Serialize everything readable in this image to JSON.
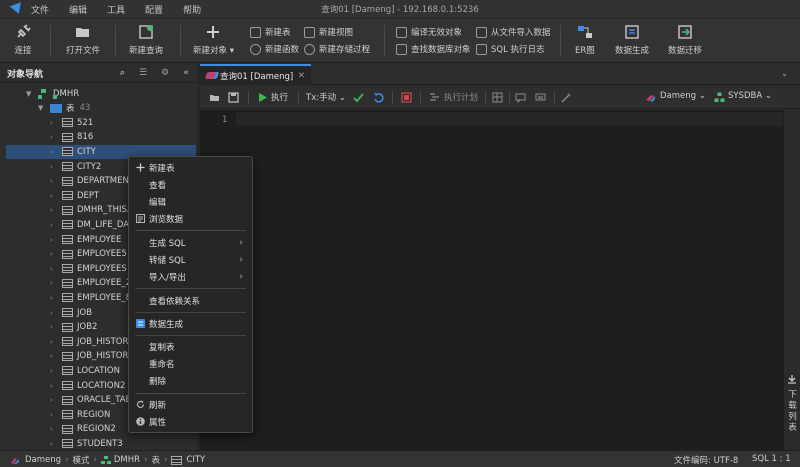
{
  "menubar": {
    "items": [
      "文件",
      "编辑",
      "工具",
      "配置",
      "帮助"
    ],
    "window_title": "查询01 [Dameng] - 192.168.0.1:5236"
  },
  "toolbar": {
    "connect": "连接",
    "open_file": "打开文件",
    "new_query": "新建查询",
    "new_object": "新建对象",
    "new_table": "新建表",
    "new_function": "新建函数",
    "new_view": "新建视图",
    "new_procedure": "新建存储过程",
    "compile_invalid": "编译无效对象",
    "find_db_object": "查找数据库对象",
    "import_from_file": "从文件导入数据",
    "sql_exec_log": "SQL 执行日志",
    "er_diagram": "ER图",
    "data_generation": "数据生成",
    "data_migration": "数据迁移"
  },
  "navigator": {
    "title": "对象导航",
    "schema": "DMHR",
    "tables_folder": "表",
    "tables_count": "43",
    "tables": [
      "521",
      "816",
      "CITY",
      "CITY2",
      "DEPARTMENT",
      "DEPT",
      "DMHR_THISA",
      "DM_LIFE_DA",
      "EMPLOYEE",
      "EMPLOYEE5",
      "EMPLOYEES",
      "EMPLOYEE_2",
      "EMPLOYEE_8",
      "JOB",
      "JOB2",
      "JOB_HISTOR",
      "JOB_HISTOR",
      "LOCATION",
      "LOCATION2",
      "ORACLE_TAB",
      "REGION",
      "REGION2",
      "STUDENT3"
    ],
    "selected": "CITY"
  },
  "editor": {
    "tab_label": "查询01 [Dameng]",
    "execute": "执行",
    "tx_mode": "Tx:手动",
    "exec_plan": "执行计划",
    "connection": "Dameng",
    "user": "SYSDBA",
    "line_numbers": [
      "1"
    ]
  },
  "right_panel": {
    "download_list": "下载列表"
  },
  "context_menu": {
    "new_table": "新建表",
    "view": "查看",
    "edit": "编辑",
    "browse_data": "浏览数据",
    "generate_sql": "生成 SQL",
    "dump_sql": "转储 SQL",
    "import_export": "导入/导出",
    "view_dependencies": "查看依赖关系",
    "data_generation": "数据生成",
    "copy_table": "复制表",
    "rename": "重命名",
    "delete": "删除",
    "refresh": "刷新",
    "properties": "属性"
  },
  "statusbar": {
    "connection": "Dameng",
    "mode": "模式",
    "schema": "DMHR",
    "object_type": "表",
    "object": "CITY",
    "encoding": "文件编码:  UTF-8",
    "position": "SQL 1 : 1"
  },
  "colors": {
    "accent": "#3a8ee6",
    "selection": "#2e4f7a",
    "schema_green": "#4fb87c",
    "run_green": "#3fb950",
    "stop_red": "#d04848"
  }
}
